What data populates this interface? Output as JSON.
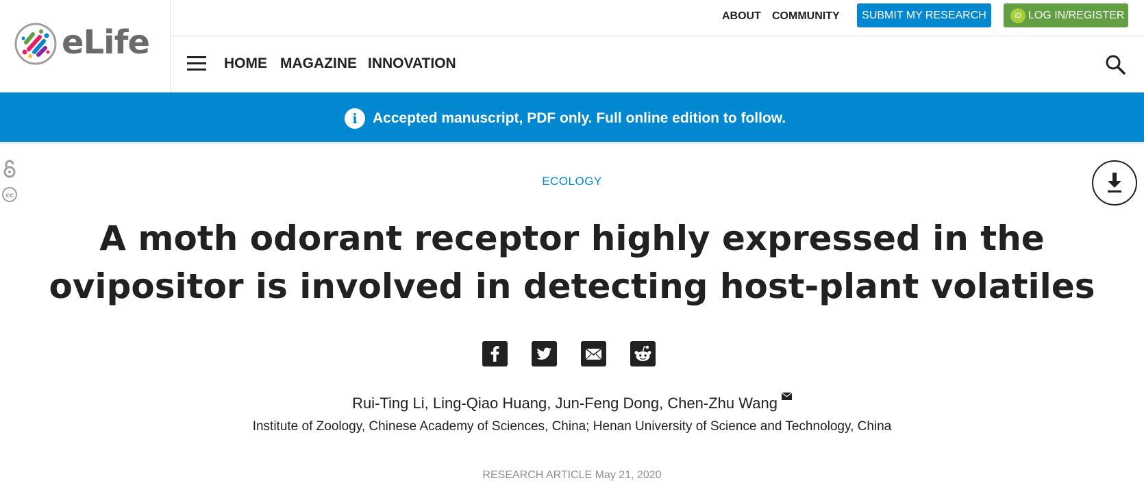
{
  "brand": {
    "name": "eLife"
  },
  "top_nav": {
    "about": "ABOUT",
    "community": "COMMUNITY",
    "submit": "SUBMIT MY RESEARCH",
    "login": "LOG IN/REGISTER",
    "orcid_glyph": "iD"
  },
  "main_nav": {
    "items": [
      "HOME",
      "MAGAZINE",
      "INNOVATION"
    ]
  },
  "banner": {
    "text": "Accepted manuscript, PDF only. Full online edition to follow.",
    "icon": "i"
  },
  "article": {
    "subject": "ECOLOGY",
    "title": "A moth odorant receptor highly expressed in the ovipositor is involved in detecting host-plant volatiles",
    "authors": [
      "Rui-Ting Li",
      "Ling-Qiao Huang",
      "Jun-Feng Dong",
      "Chen-Zhu Wang"
    ],
    "authors_sep": ", ",
    "affiliations": "Institute of Zoology, Chinese Academy of Sciences, China; Henan University of Science and Technology, China",
    "type": "RESEARCH ARTICLE",
    "date": "May 21, 2020"
  },
  "share": {
    "icons": [
      "facebook-icon",
      "twitter-icon",
      "email-icon",
      "reddit-icon"
    ]
  },
  "colors": {
    "brand_blue": "#0288d1",
    "login_green": "#629f43",
    "orcid_green": "#a6ce39",
    "text_dark": "#212121",
    "muted": "#8e8e8e"
  }
}
